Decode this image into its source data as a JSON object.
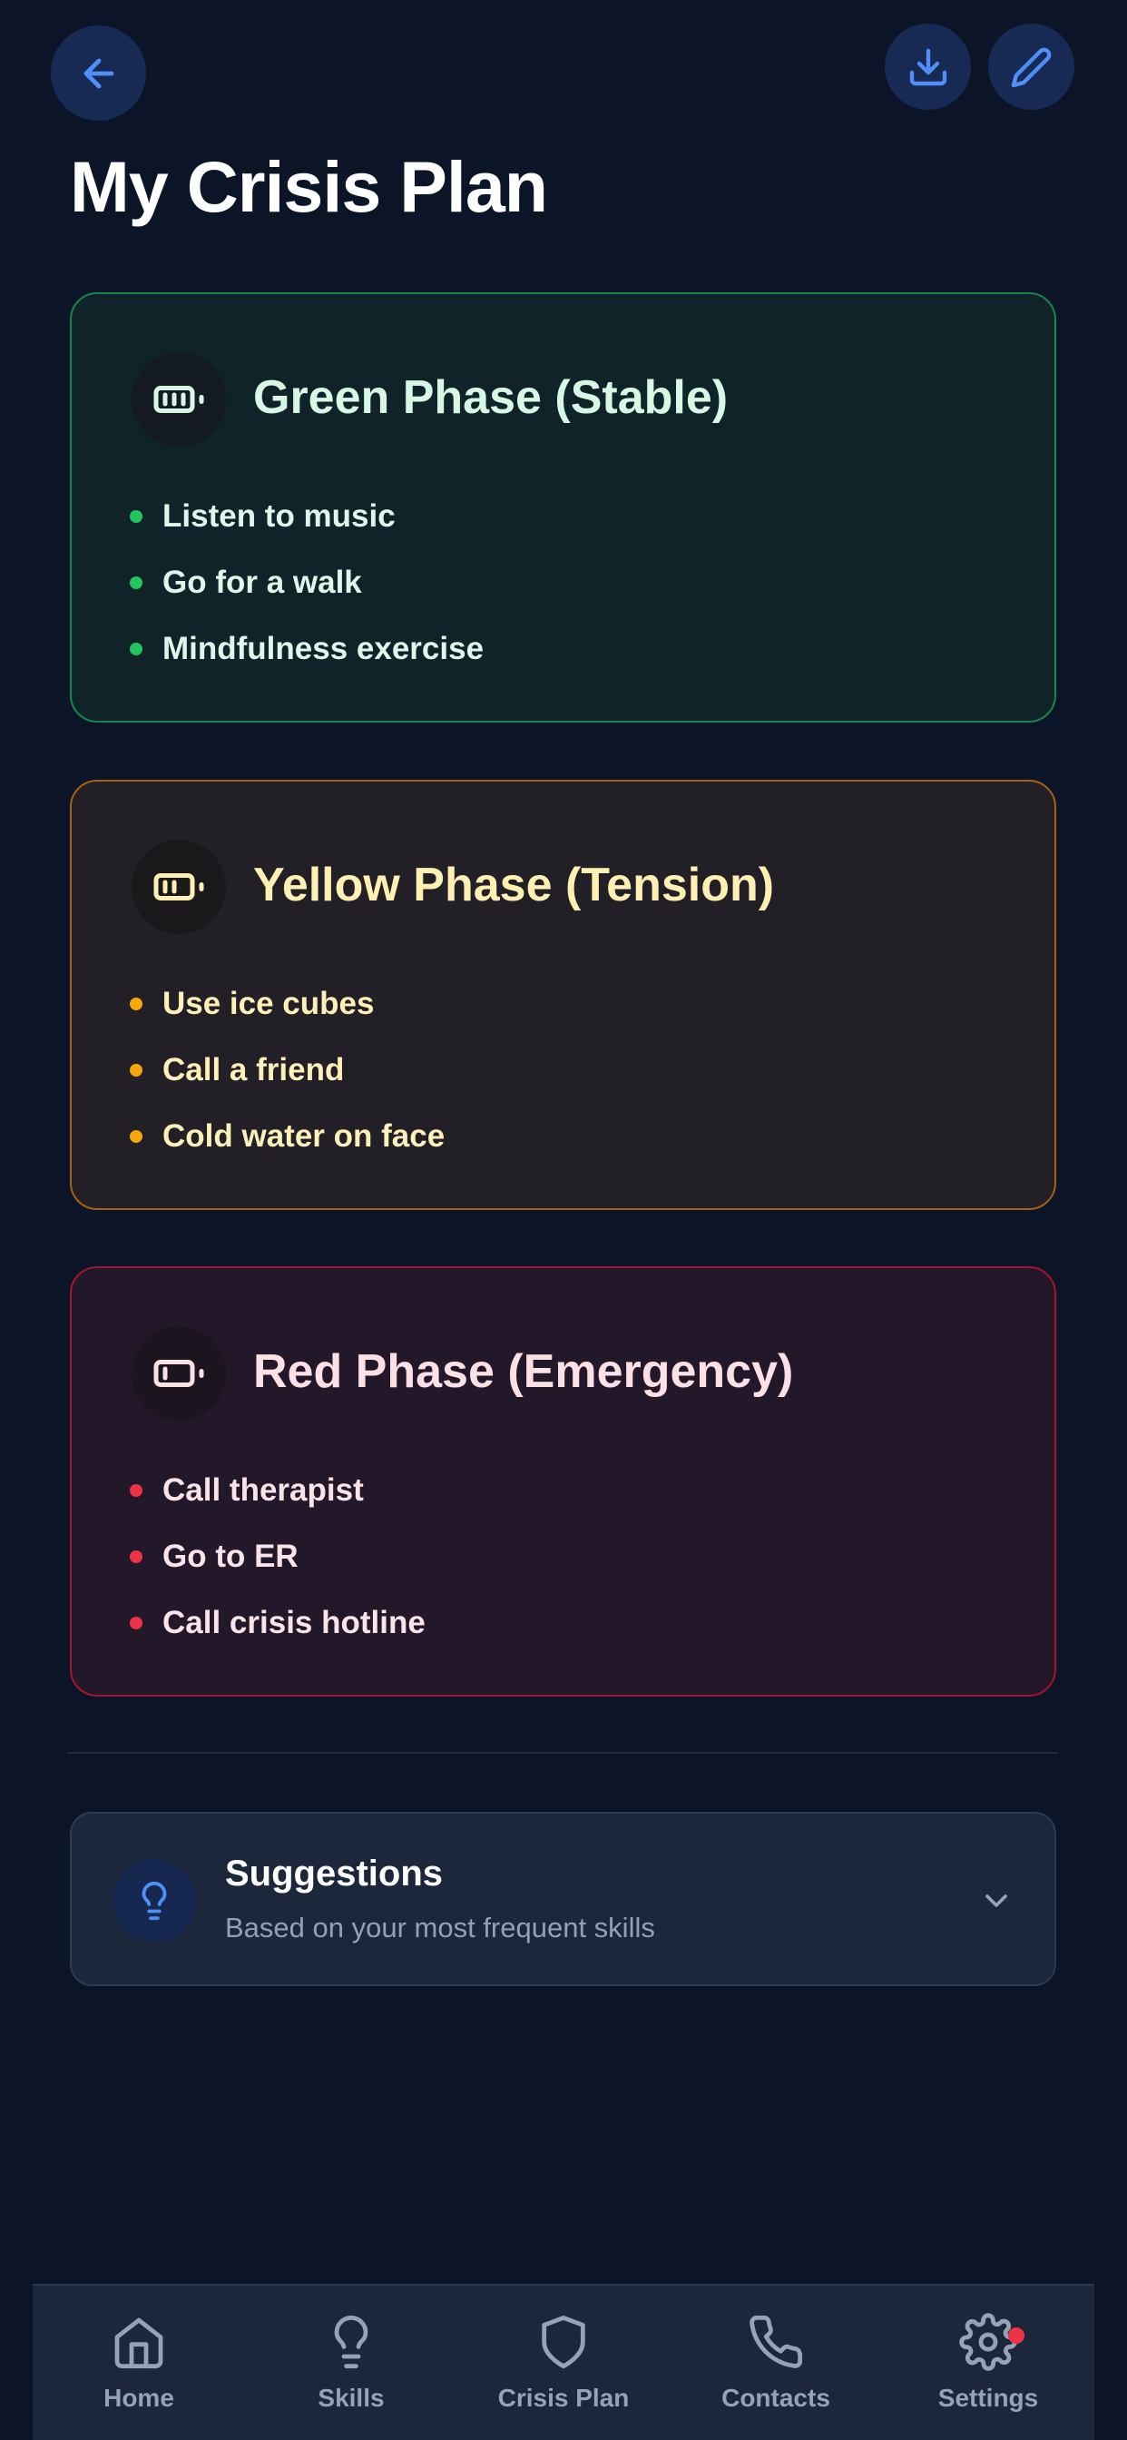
{
  "header": {
    "title": "My Crisis Plan",
    "back_icon": "arrow-left-icon",
    "download_icon": "download-icon",
    "edit_icon": "pencil-icon"
  },
  "phases": [
    {
      "title": "Green Phase (Stable)",
      "icon": "battery-full-icon",
      "accent": "#22c55e",
      "items": [
        "Listen to music",
        "Go for a walk",
        "Mindfulness exercise"
      ]
    },
    {
      "title": "Yellow Phase (Tension)",
      "icon": "battery-medium-icon",
      "accent": "#f5a70b",
      "items": [
        "Use ice cubes",
        "Call a friend",
        "Cold water on face"
      ]
    },
    {
      "title": "Red Phase (Emergency)",
      "icon": "battery-low-icon",
      "accent": "#ef3346",
      "items": [
        "Call therapist",
        "Go to ER",
        "Call crisis hotline"
      ]
    }
  ],
  "suggestions": {
    "title": "Suggestions",
    "subtitle": "Based on your most frequent skills",
    "icon": "lightbulb-icon",
    "expand_icon": "chevron-down-icon"
  },
  "nav": {
    "items": [
      {
        "label": "Home",
        "icon": "home-icon"
      },
      {
        "label": "Skills",
        "icon": "lightbulb-icon"
      },
      {
        "label": "Crisis Plan",
        "icon": "shield-icon"
      },
      {
        "label": "Contacts",
        "icon": "phone-icon"
      },
      {
        "label": "Settings",
        "icon": "gear-icon"
      }
    ]
  },
  "colors": {
    "background": "#0c1427",
    "primary": "#3b82f6",
    "notification": "#ef3346"
  }
}
